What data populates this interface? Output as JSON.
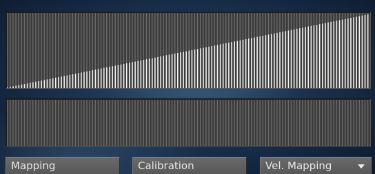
{
  "velocity_table": {
    "bar_count": 128,
    "range": [
      0,
      127
    ],
    "curve": "linear",
    "background_color": "#3b3b3b",
    "column_color": "#6a6a6a",
    "value_color": "#f2f2f2"
  },
  "calibration_table": {
    "bar_count": 128,
    "values": "all zero"
  },
  "buttons": {
    "mapping_label": "Mapping",
    "calibration_label": "Calibration",
    "vel_mapping_label": "Vel. Mapping"
  }
}
